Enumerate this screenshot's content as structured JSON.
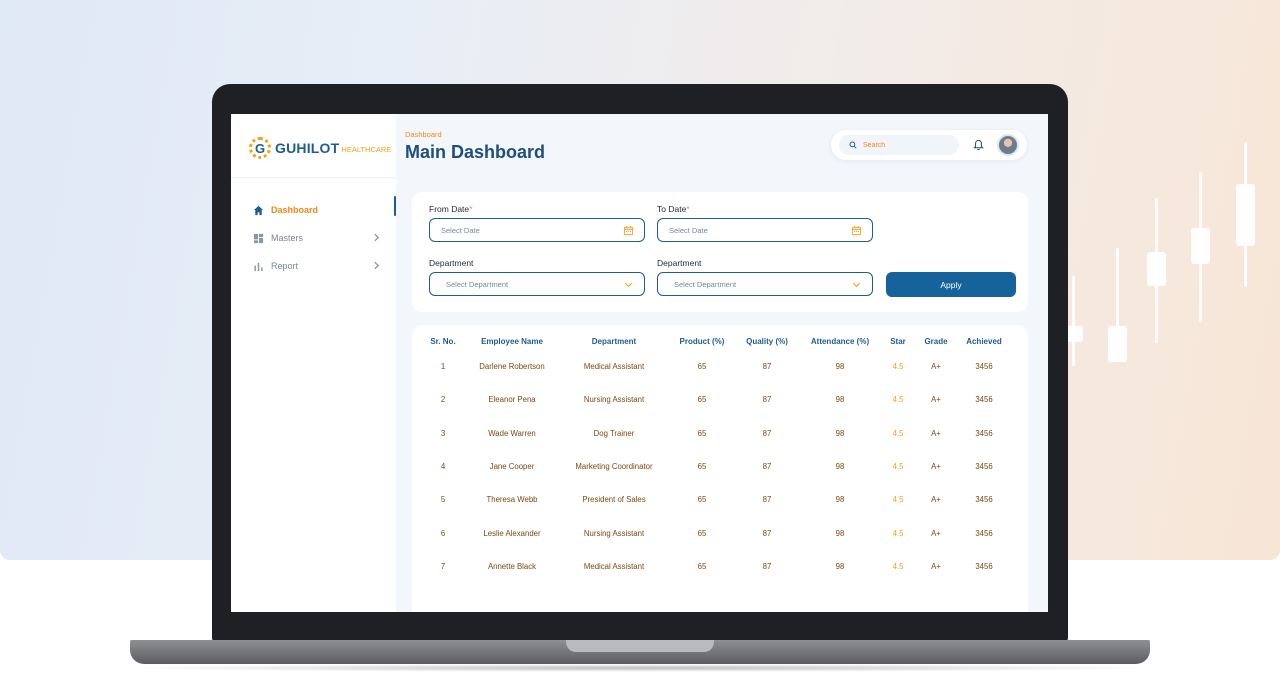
{
  "brand": {
    "mark": "G",
    "name": "GUHILOT",
    "sub": "HEALTHCARE"
  },
  "sidebar": {
    "items": [
      {
        "label": "Dashboard",
        "icon": "home-icon",
        "active": true
      },
      {
        "label": "Masters",
        "icon": "grid-icon",
        "active": false
      },
      {
        "label": "Report",
        "icon": "bar-chart-icon",
        "active": false
      }
    ]
  },
  "header": {
    "breadcrumb": "Dashboard",
    "title": "Main Dashboard",
    "search_placeholder": "Search"
  },
  "filters": {
    "from_date_label": "From Date",
    "to_date_label": "To Date",
    "required_mark": "*",
    "date_placeholder": "Select Date",
    "department_label_1": "Department",
    "department_label_2": "Department",
    "department_placeholder": "Select Department",
    "apply_label": "Apply"
  },
  "table": {
    "columns": [
      "Sr. No.",
      "Employee Name",
      "Department",
      "Product (%)",
      "Quality (%)",
      "Attendance (%)",
      "Star",
      "Grade",
      "Achieved"
    ],
    "rows": [
      [
        "1",
        "Darlene Robertson",
        "Medical Assistant",
        "65",
        "87",
        "98",
        "4.5",
        "A+",
        "3456"
      ],
      [
        "2",
        "Eleanor Pena",
        "Nursing Assistant",
        "65",
        "87",
        "98",
        "4.5",
        "A+",
        "3456"
      ],
      [
        "3",
        "Wade Warren",
        "Dog Trainer",
        "65",
        "87",
        "98",
        "4.5",
        "A+",
        "3456"
      ],
      [
        "4",
        "Jane Cooper",
        "Marketing Coordinator",
        "65",
        "87",
        "98",
        "4.5",
        "A+",
        "3456"
      ],
      [
        "5",
        "Theresa Webb",
        "President of Sales",
        "65",
        "87",
        "98",
        "4.5",
        "A+",
        "3456"
      ],
      [
        "6",
        "Leslie Alexander",
        "Nursing Assistant",
        "65",
        "87",
        "98",
        "4.5",
        "A+",
        "3456"
      ],
      [
        "7",
        "Annette Black",
        "Medical Assistant",
        "65",
        "87",
        "98",
        "4.5",
        "A+",
        "3456"
      ]
    ]
  },
  "colors": {
    "primary": "#1e5d8f",
    "accent": "#ef8a17",
    "star": "#f0a21a",
    "cell_text": "#7a4a12"
  }
}
